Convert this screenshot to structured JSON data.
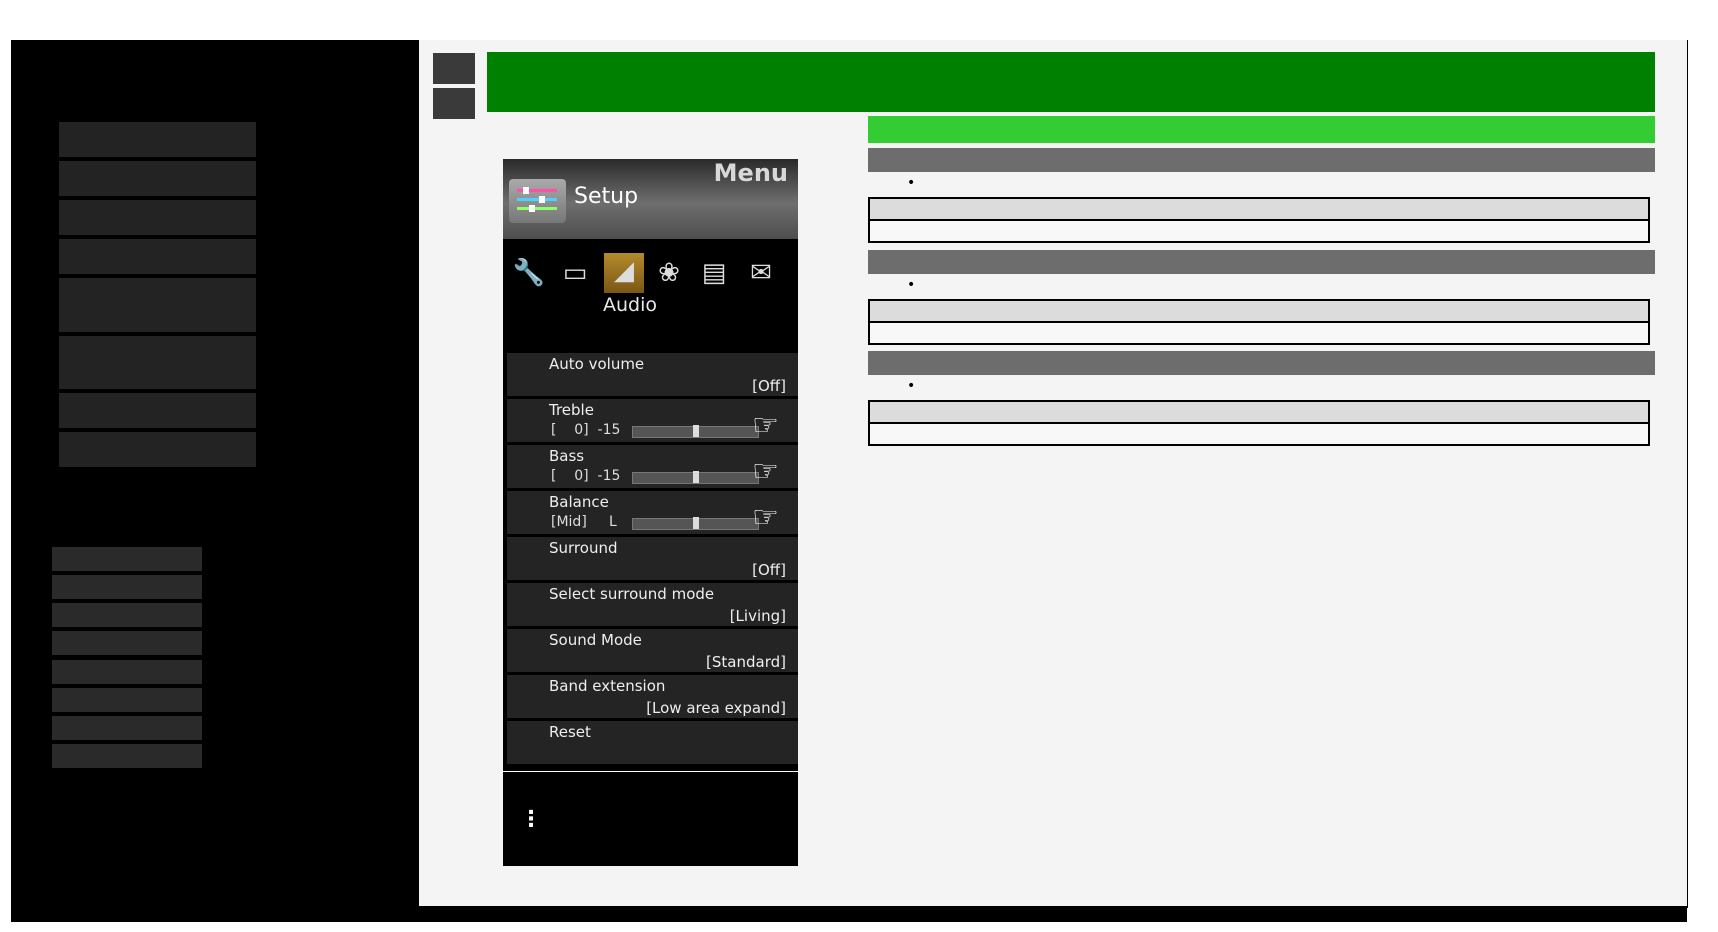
{
  "tv_menu": {
    "title": "Menu",
    "section_label": "Setup",
    "active_category": "Audio",
    "category_icons": [
      "wrench-icon",
      "monitor-icon",
      "speaker-icon",
      "leaf-icon",
      "toolbox-icon",
      "envelope-icon"
    ],
    "items": [
      {
        "label": "Auto volume",
        "value": "[Off]"
      },
      {
        "label": "Treble",
        "slider_text": "[    0]  -15",
        "slider_level": 0.5
      },
      {
        "label": "Bass",
        "slider_text": "[    0]  -15",
        "slider_level": 0.5
      },
      {
        "label": "Balance",
        "slider_text": "[Mid]     L",
        "slider_level": 0.5
      },
      {
        "label": "Surround",
        "value": "[Off]"
      },
      {
        "label": "Select surround mode",
        "value": "[Living]"
      },
      {
        "label": "Sound Mode",
        "value": "[Standard]"
      },
      {
        "label": "Band extension",
        "value": "[Low area expand]"
      },
      {
        "label": "Reset"
      }
    ],
    "more_glyph": "⋮"
  },
  "content": {
    "bullet_glyph": "•"
  },
  "colors": {
    "banner": "#008000",
    "subbanner": "#33cc33",
    "section_header": "#6d6d6d"
  }
}
